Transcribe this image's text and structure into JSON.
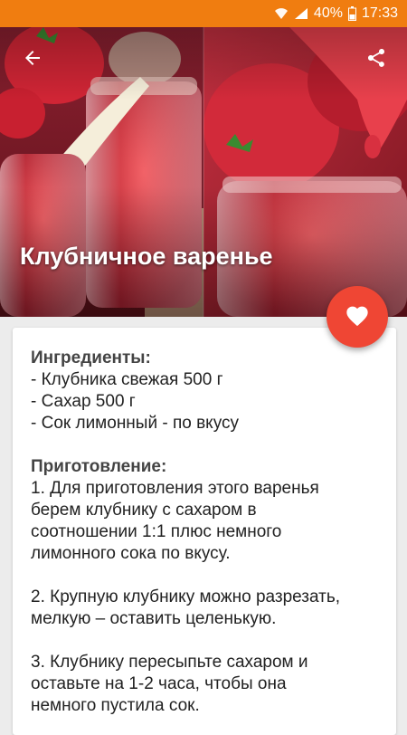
{
  "status_bar": {
    "battery": "40%",
    "time": "17:33"
  },
  "recipe": {
    "title": "Клубничное варенье",
    "ingredients_heading": "Ингредиенты:",
    "ingredients": [
      "- Клубника свежая 500 г",
      "- Сахар 500 г",
      "- Сок лимонный - по вкусу"
    ],
    "preparation_heading": "Приготовление:",
    "steps": [
      [
        "1. Для приготовления этого варенья",
        "берем клубнику с сахаром в",
        "соотношении 1:1 плюс немного",
        "лимонного сока по вкусу."
      ],
      [
        "2. Крупную клубнику можно разрезать,",
        "мелкую – оставить целенькую."
      ],
      [
        "3. Клубнику пересыпьте сахаром и",
        "оставьте на 1-2 часа, чтобы она",
        "немного пустила сок."
      ]
    ]
  },
  "icons": {
    "back": "arrow-back-icon",
    "share": "share-icon",
    "favorite": "heart-icon",
    "wifi": "wifi-icon",
    "signal": "signal-icon",
    "battery": "battery-icon"
  },
  "colors": {
    "status_bar": "#f07d10",
    "fab": "#ef4634"
  }
}
